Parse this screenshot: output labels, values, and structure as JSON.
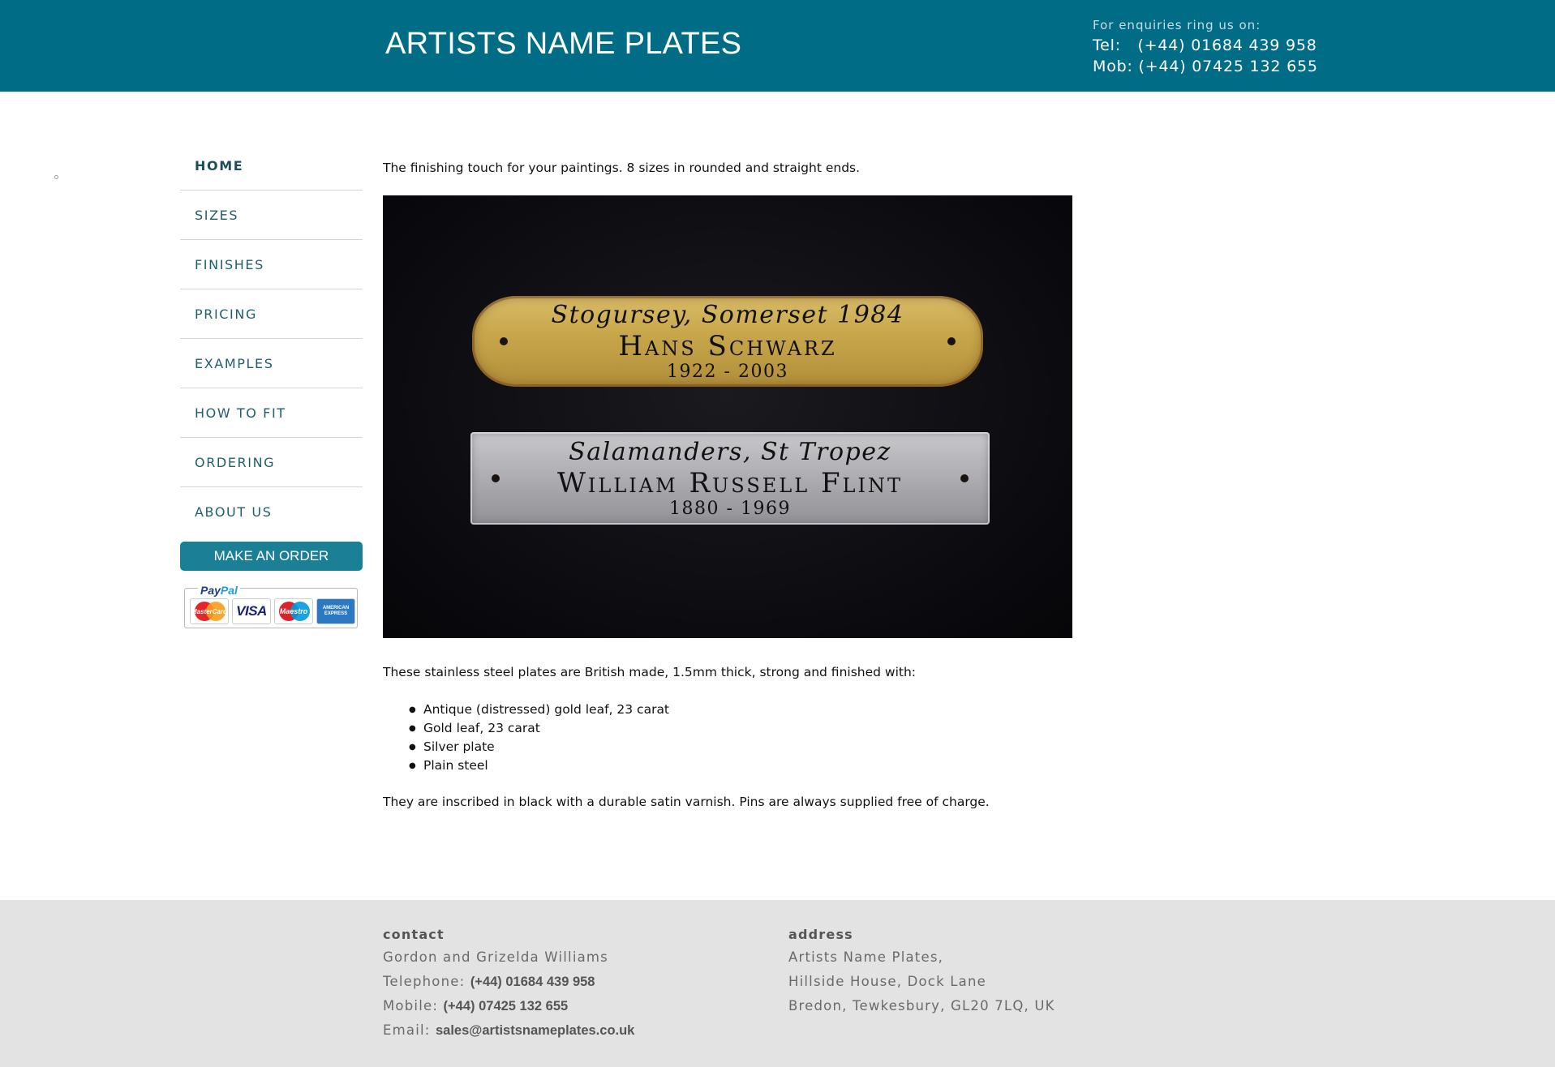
{
  "header": {
    "title": "ARTISTS NAME PLATES",
    "enquiries_label": "For enquiries ring us on:",
    "tel_line": "Tel:   (+44) 01684 439 958",
    "mob_line": "Mob: (+44) 07425 132 655"
  },
  "nav": {
    "items": [
      {
        "label": "HOME",
        "active": true
      },
      {
        "label": "SIZES"
      },
      {
        "label": "FINISHES"
      },
      {
        "label": "PRICING"
      },
      {
        "label": "EXAMPLES"
      },
      {
        "label": "HOW TO FIT"
      },
      {
        "label": "ORDERING"
      },
      {
        "label": "ABOUT US"
      }
    ],
    "order_button": "MAKE AN ORDER"
  },
  "payment": {
    "logo_pay": "Pay",
    "logo_pal": "Pal",
    "cards": [
      "MasterCard",
      "VISA",
      "Maestro",
      "AMERICAN EXPRESS"
    ]
  },
  "main": {
    "intro": "The finishing touch for your paintings. 8 sizes in rounded and straight ends.",
    "photo": {
      "gold_plate": {
        "line1": "Stogursey, Somerset 1984",
        "line2": "Hans Schwarz",
        "line3": "1922 - 2003"
      },
      "silver_plate": {
        "line1": "Salamanders, St Tropez",
        "line2": "William Russell Flint",
        "line3": "1880 - 1969"
      }
    },
    "para2": "These stainless steel plates are British made, 1.5mm thick, strong and finished with:",
    "finishes": [
      "Antique (distressed) gold leaf, 23 carat",
      "Gold leaf, 23 carat",
      "Silver plate",
      "Plain steel"
    ],
    "para3": "They are inscribed in black with a durable satin varnish. Pins are always supplied free of charge."
  },
  "footer": {
    "contact": {
      "heading": "contact",
      "names": "Gordon and Grizelda Williams",
      "tel_label": "Telephone: ",
      "tel_value": "(+44) 01684 439 958",
      "mob_label": "Mobile: ",
      "mob_value": "(+44) 07425 132 655",
      "email_label": "Email: ",
      "email_value": "sales@artistsnameplates.co.uk"
    },
    "address": {
      "heading": "address",
      "line1": "Artists Name Plates,",
      "line2": "Hillside House, Dock Lane",
      "line3": "Bredon, Tewkesbury, GL20 7LQ, UK"
    }
  },
  "colors": {
    "header_bg": "#016c86",
    "button_bg": "#1b7f96",
    "nav_text": "#1f5f6c",
    "footer_bg": "#e3e3e3"
  }
}
